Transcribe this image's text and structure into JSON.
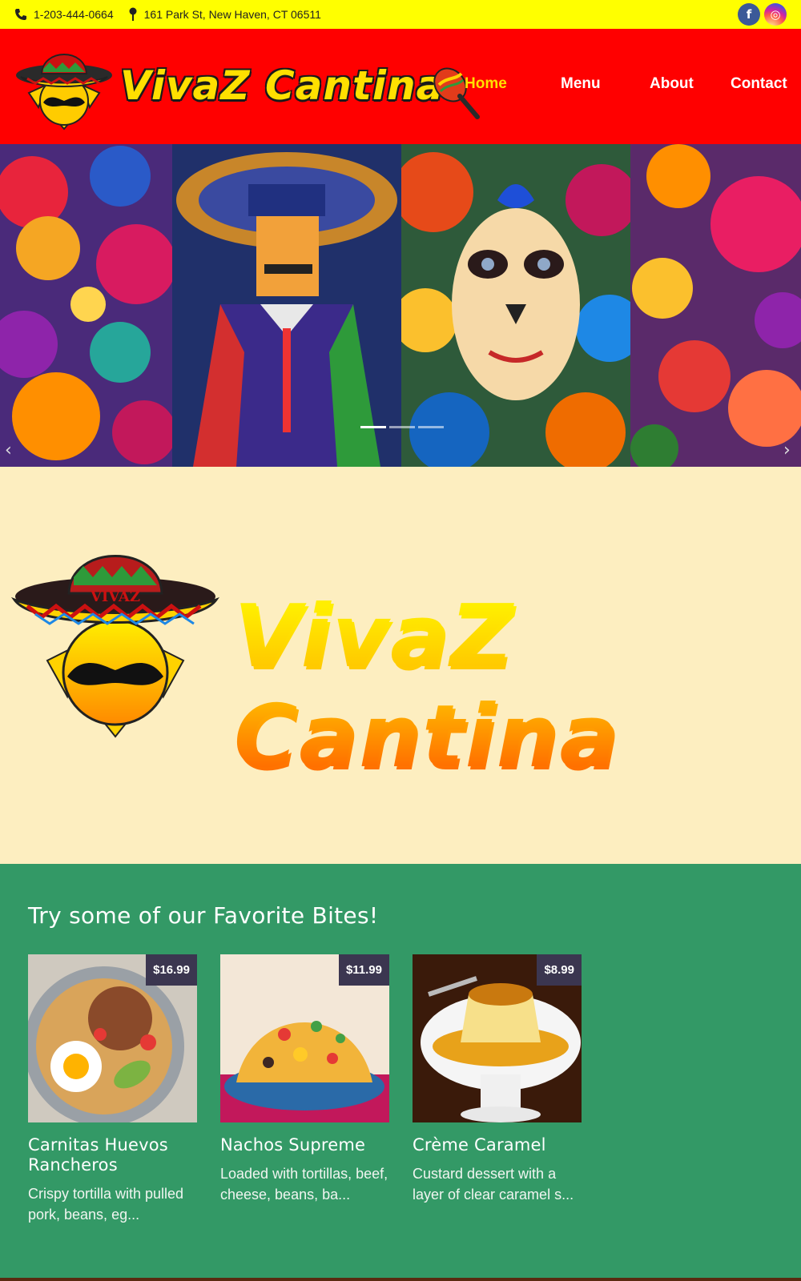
{
  "topbar": {
    "phone": "1-203-444-0664",
    "address": "161 Park St, New Haven, CT 06511",
    "facebook_glyph": "f",
    "instagram_glyph": "◎"
  },
  "header": {
    "brand": "VivaZ Cantina",
    "nav": [
      "Home",
      "Menu",
      "About",
      "Contact"
    ],
    "active_nav": "Home",
    "colors": {
      "bar": "#ffff00",
      "header": "#ff0000",
      "active": "#ffe000"
    }
  },
  "slider": {
    "prev_glyph": "‹",
    "next_glyph": "›",
    "slides": 3,
    "active_slide": 1
  },
  "hero": {
    "brand": "VivaZ Cantina",
    "hat_band": "VIVAZ"
  },
  "favorites": {
    "heading": "Try some of our Favorite Bites!",
    "items": [
      {
        "name": "Carnitas Huevos Rancheros",
        "price": "$16.99",
        "desc": "Crispy tortilla with pulled pork, beans, eg..."
      },
      {
        "name": "Nachos Supreme",
        "price": "$11.99",
        "desc": "Loaded with tortillas, beef, cheese, beans, ba..."
      },
      {
        "name": "Crème Caramel",
        "price": "$8.99",
        "desc": "Custard dessert with a layer of clear caramel s..."
      }
    ],
    "colors": {
      "background": "#339966",
      "price_tag": "#3b3650"
    }
  }
}
